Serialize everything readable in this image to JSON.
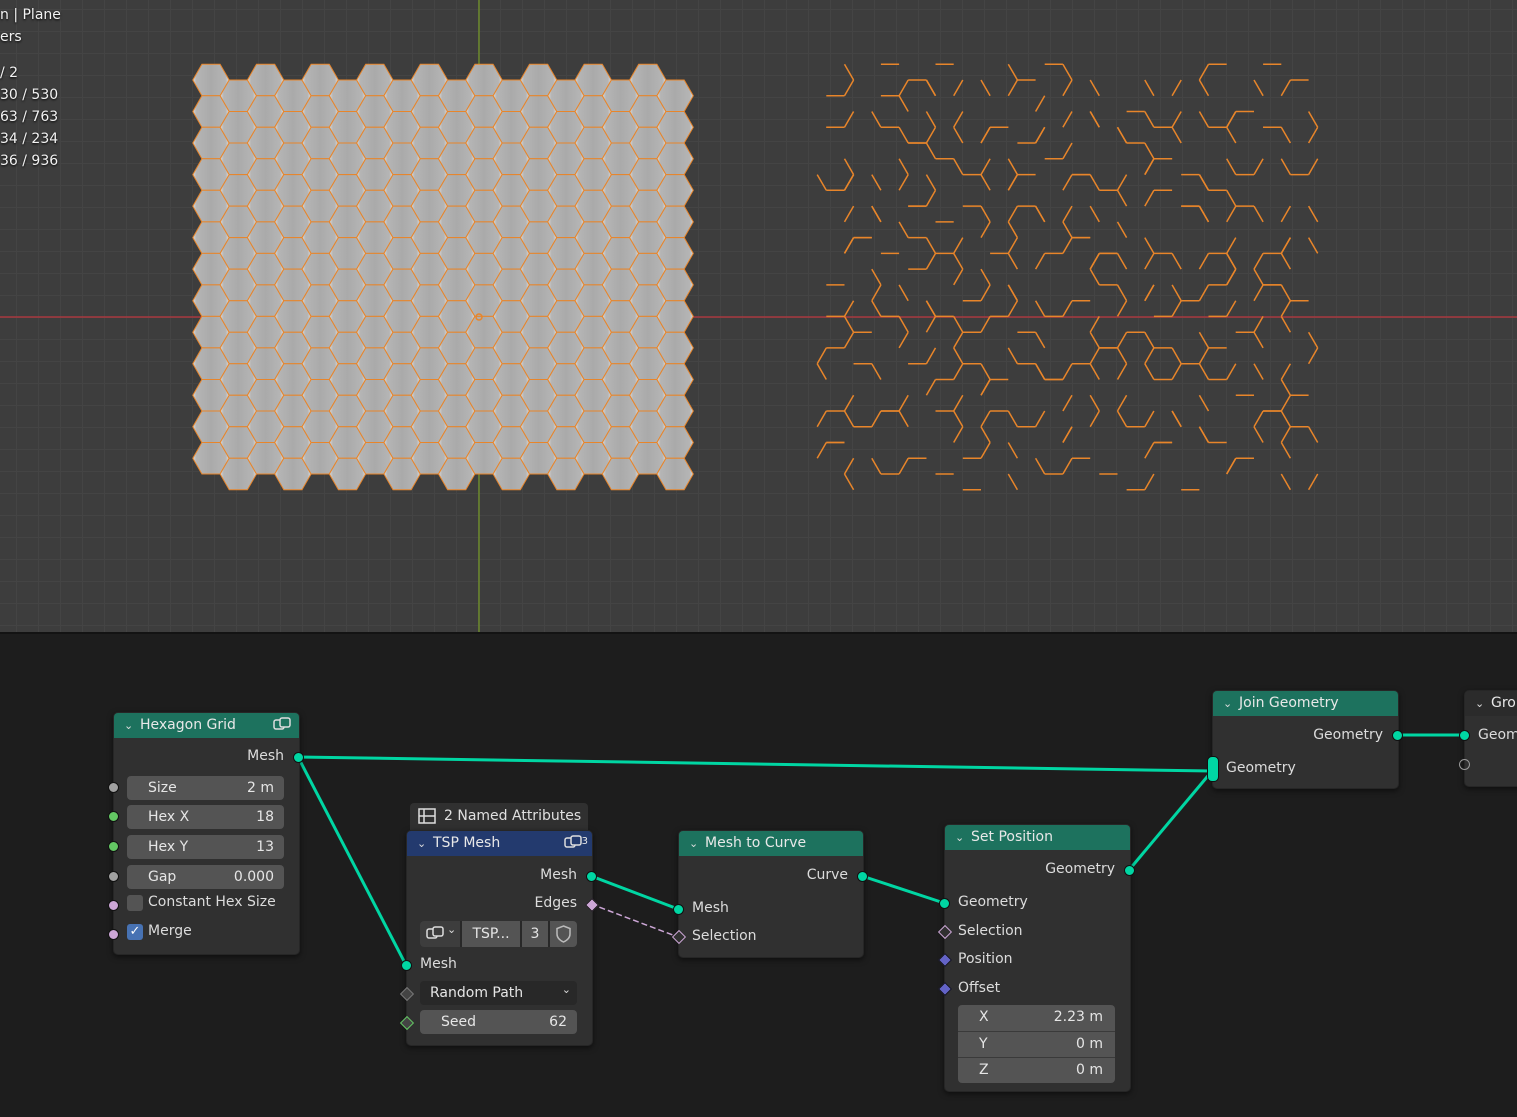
{
  "viewport": {
    "stats": [
      {
        "text": "n | Plane"
      },
      {
        "text": "ers"
      },
      {
        "text": "/ 2"
      },
      {
        "text": "30 / 530"
      },
      {
        "text": "63 / 763"
      },
      {
        "text": "34 / 234"
      },
      {
        "text": "36 / 936"
      }
    ],
    "colors": {
      "selection": "#e8852a",
      "mesh_fill": "#b9b9b9",
      "x_axis": "#a8383e",
      "y_axis": "#6c8a2c"
    }
  },
  "nodes": {
    "hexagon_grid": {
      "title": "Hexagon Grid",
      "output_mesh": "Mesh",
      "size_label": "Size",
      "size_value": "2 m",
      "hexx_label": "Hex X",
      "hexx_value": "18",
      "hexy_label": "Hex Y",
      "hexy_value": "13",
      "gap_label": "Gap",
      "gap_value": "0.000",
      "constant_label": "Constant Hex Size",
      "constant_checked": false,
      "merge_label": "Merge",
      "merge_checked": true
    },
    "tsp_mesh": {
      "panel_label": "2 Named Attributes",
      "title": "TSP Mesh",
      "group_user_count": "3",
      "output_mesh": "Mesh",
      "output_edges": "Edges",
      "datablock_name": "TSP...",
      "datablock_users": "3",
      "input_mesh": "Mesh",
      "mode_value": "Random Path",
      "seed_label": "Seed",
      "seed_value": "62"
    },
    "mesh_to_curve": {
      "title": "Mesh to Curve",
      "output_curve": "Curve",
      "input_mesh": "Mesh",
      "input_selection": "Selection"
    },
    "set_position": {
      "title": "Set Position",
      "output_geometry": "Geometry",
      "input_geometry": "Geometry",
      "input_selection": "Selection",
      "input_position": "Position",
      "input_offset": "Offset",
      "offset_x_label": "X",
      "offset_x_value": "2.23 m",
      "offset_y_label": "Y",
      "offset_y_value": "0 m",
      "offset_z_label": "Z",
      "offset_z_value": "0 m"
    },
    "join_geometry": {
      "title": "Join Geometry",
      "output_geometry": "Geometry",
      "input_geometry": "Geometry"
    },
    "group_output": {
      "title": "Gro",
      "input_geometry": "Geom"
    }
  },
  "colors": {
    "geometry_socket": "#00d6a3",
    "geo_header": "#1d725e",
    "group_header": "#233a6e",
    "link": "#00d6a3",
    "field_link": "#cca6d6"
  }
}
